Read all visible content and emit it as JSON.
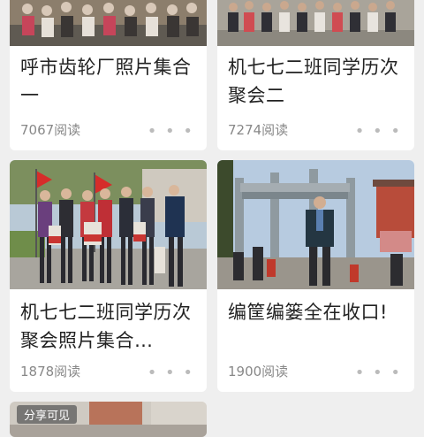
{
  "cards": [
    {
      "title": "呼市齿轮厂照片集合一",
      "reads": "7067阅读",
      "more_label": "• • •"
    },
    {
      "title": "机七七二班同学历次聚会二",
      "reads": "7274阅读",
      "more_label": "• • •"
    },
    {
      "title": "机七七二班同学历次聚会照片集合…",
      "reads": "1878阅读",
      "more_label": "• • •"
    },
    {
      "title": "编筐编篓全在收口!",
      "reads": "1900阅读",
      "more_label": "• • •"
    }
  ],
  "partial_card": {
    "badge": "分享可见"
  },
  "colors": {
    "background": "#efefef",
    "card": "#ffffff",
    "meta_text": "#888888"
  }
}
